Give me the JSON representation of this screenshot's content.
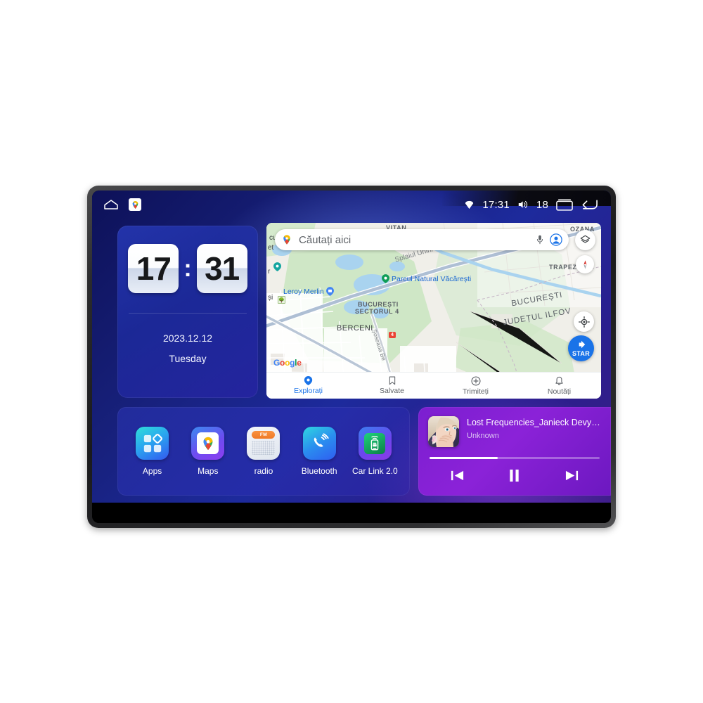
{
  "device": {
    "name": "car-head-unit"
  },
  "statusbar": {
    "home_icon": "home-icon",
    "maps_shortcut_icon": "google-maps-icon",
    "gps_icon": "gps-location-icon",
    "time": "17:31",
    "volume_icon": "volume-icon",
    "volume_level": "18",
    "recents_icon": "recents-icon",
    "back_icon": "back-icon"
  },
  "clock_widget": {
    "hours": "17",
    "minutes": "31",
    "separator": ":",
    "date": "2023.12.12",
    "weekday": "Tuesday"
  },
  "map_widget": {
    "search_placeholder": "Căutați aici",
    "mic_icon": "microphone-icon",
    "account_icon": "account-avatar-icon",
    "layers_icon": "layers-icon",
    "compass_icon": "compass-icon",
    "mylocation_icon": "my-location-icon",
    "start_button_label": "STAR",
    "start_icon": "navigation-arrow-icon",
    "google_logo": {
      "g": "G",
      "o1": "o",
      "o2": "o",
      "g2": "g",
      "l": "l",
      "e": "e"
    },
    "labels": [
      {
        "text": "VITAN",
        "kind": "area"
      },
      {
        "text": "OZANA",
        "kind": "area"
      },
      {
        "text": "Splaiul Unirii",
        "kind": "road"
      },
      {
        "text": "Unirii",
        "kind": "road"
      },
      {
        "text": "Parcul Natural Văcărești",
        "kind": "poi"
      },
      {
        "text": "Leroy Merlin",
        "kind": "poi"
      },
      {
        "text": "TRAPEZULUI",
        "kind": "area"
      },
      {
        "text": "BUCUREȘTI",
        "kind": "region"
      },
      {
        "text": "JUDEȚUL ILFOV",
        "kind": "region"
      },
      {
        "text": "BUCUREȘTI SECTORUL 4",
        "kind": "area"
      },
      {
        "text": "BERCENI",
        "kind": "place"
      },
      {
        "text": "Șoseaua Be",
        "kind": "road"
      },
      {
        "text": "și",
        "kind": "place"
      },
      {
        "text": "cul",
        "kind": "place"
      },
      {
        "text": "et",
        "kind": "place"
      },
      {
        "text": "r",
        "kind": "place"
      }
    ],
    "map_text": {
      "vitan": "VITAN",
      "ozana": "OZANA",
      "splaiul": "Splaiul Unirii",
      "unirii": "Unirii",
      "parcul": "Parcul Natural Văcărești",
      "leroy": "Leroy Merlin",
      "trapezului": "TRAPEZULUI",
      "bucuresti": "BUCUREȘTI",
      "judetul": "JUDEȚUL ILFOV",
      "sector4_line1": "BUCUREȘTI",
      "sector4_line2": "SECTORUL 4",
      "berceni": "BERCENI",
      "soseaua": "Șoseaua Be",
      "si": "și",
      "cul": "cul",
      "et": "et",
      "r": "r",
      "highway_shield": "4"
    },
    "bottom_nav": [
      {
        "label": "Explorați",
        "icon": "explore-pin-icon",
        "active": true
      },
      {
        "label": "Salvate",
        "icon": "bookmark-icon",
        "active": false
      },
      {
        "label": "Trimiteți",
        "icon": "contribute-plus-icon",
        "active": false
      },
      {
        "label": "Noutăți",
        "icon": "bell-updates-icon",
        "active": false
      }
    ]
  },
  "dock": {
    "apps": [
      {
        "label": "Apps",
        "icon": "apps-grid-icon"
      },
      {
        "label": "Maps",
        "icon": "google-maps-icon"
      },
      {
        "label": "radio",
        "icon": "fm-radio-icon",
        "band": "FM"
      },
      {
        "label": "Bluetooth",
        "icon": "bluetooth-phone-icon"
      },
      {
        "label": "Car Link 2.0",
        "icon": "car-link-icon"
      }
    ]
  },
  "music_widget": {
    "album_art_icon": "album-art",
    "track_title": "Lost Frequencies_Janieck Devy-...",
    "artist": "Unknown",
    "progress_percent": 40,
    "controls": {
      "previous": "previous-track-icon",
      "play_pause": "pause-icon",
      "next": "next-track-icon"
    }
  },
  "colors": {
    "accent_blue": "#1a73e8",
    "music_purple": "#8b22d8",
    "wallpaper_navy": "#17207a",
    "fm_orange": "#ef7a27"
  }
}
